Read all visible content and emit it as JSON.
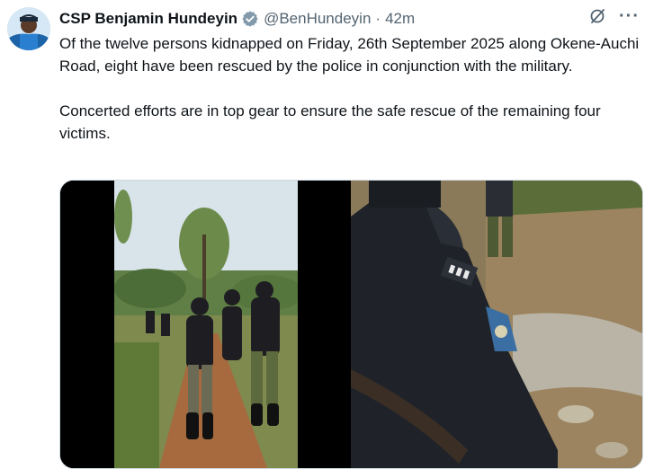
{
  "author": {
    "name": "CSP Benjamin Hundeyin",
    "handle": "@BenHundeyin",
    "separator": "·",
    "time": "42m",
    "verified_icon": "verified-badge-icon"
  },
  "actions": {
    "grok_icon": "grok-slash-icon",
    "more_label": "···"
  },
  "tweet": {
    "paragraph1": "Of the twelve persons kidnapped on Friday, 26th September 2025 along Okene-Auchi Road, eight have been rescued by the police in conjunction with the military.",
    "paragraph2": "Concerted efforts are in top gear to ensure the safe rescue of the remaining four victims."
  },
  "colors": {
    "text": "#0f1419",
    "secondary": "#536471",
    "verified": "#829aab"
  }
}
